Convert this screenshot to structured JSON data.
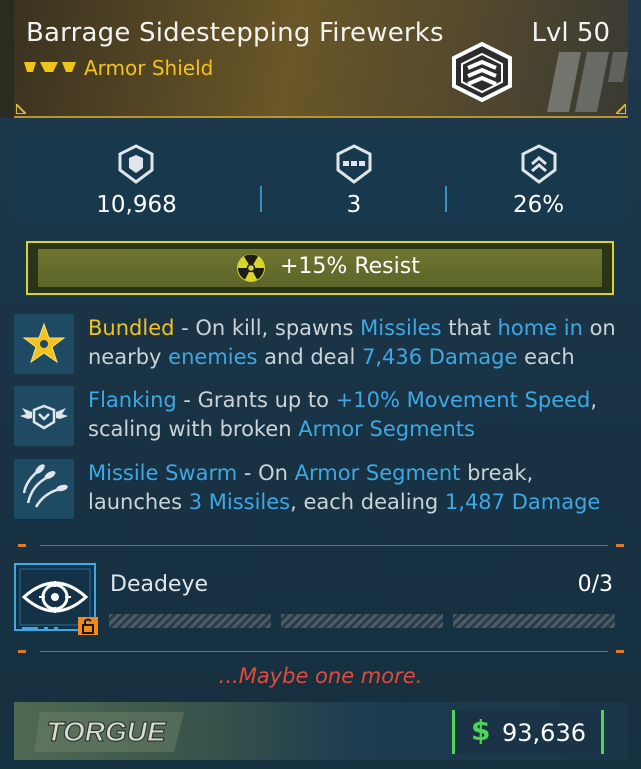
{
  "item": {
    "name": "Barrage Sidestepping Firewerks",
    "level": "Lvl 50",
    "type": "Armor Shield",
    "rarity_color": "#f2c31c"
  },
  "stats": {
    "capacity": "10,968",
    "segments": "3",
    "resist_percent": "26%"
  },
  "resist_bar": {
    "text": "+15% Resist",
    "element": "radiation",
    "icon": "radiation-icon"
  },
  "perks": [
    {
      "icon": "bundled-star-icon",
      "parts": [
        {
          "t": "Bundled",
          "c": "y"
        },
        {
          "t": " - On kill, spawns ",
          "c": ""
        },
        {
          "t": "Missiles",
          "c": "b"
        },
        {
          "t": " that ",
          "c": ""
        },
        {
          "t": "home in",
          "c": "b"
        },
        {
          "t": " on nearby ",
          "c": ""
        },
        {
          "t": "enemies",
          "c": "b"
        },
        {
          "t": " and deal ",
          "c": ""
        },
        {
          "t": "7,436 Damage",
          "c": "b"
        },
        {
          "t": " each",
          "c": ""
        }
      ]
    },
    {
      "icon": "flanking-wings-icon",
      "parts": [
        {
          "t": "Flanking",
          "c": "b"
        },
        {
          "t": " - Grants up to ",
          "c": ""
        },
        {
          "t": "+10% Movement Speed",
          "c": "b"
        },
        {
          "t": ", scaling with broken ",
          "c": ""
        },
        {
          "t": "Armor Segments",
          "c": "b"
        }
      ]
    },
    {
      "icon": "missile-swarm-icon",
      "parts": [
        {
          "t": "Missile Swarm",
          "c": "b"
        },
        {
          "t": " - On ",
          "c": ""
        },
        {
          "t": "Armor Segment",
          "c": "b"
        },
        {
          "t": " break, launches ",
          "c": ""
        },
        {
          "t": "3 Missiles",
          "c": "b"
        },
        {
          "t": ", each dealing ",
          "c": ""
        },
        {
          "t": "1,487 Damage",
          "c": "b"
        }
      ]
    }
  ],
  "skill": {
    "name": "Deadeye",
    "ranks": "0/3",
    "icon": "eye-target-icon",
    "locked": true
  },
  "flavor_text": "...Maybe one more.",
  "footer": {
    "manufacturer": "TORGUE",
    "currency_symbol": "$",
    "price": "93,636"
  },
  "colors": {
    "accent_yellow": "#f2c31c",
    "accent_blue": "#3da8e4",
    "flavor_red": "#e24a3a",
    "price_green": "#4fd45a"
  }
}
